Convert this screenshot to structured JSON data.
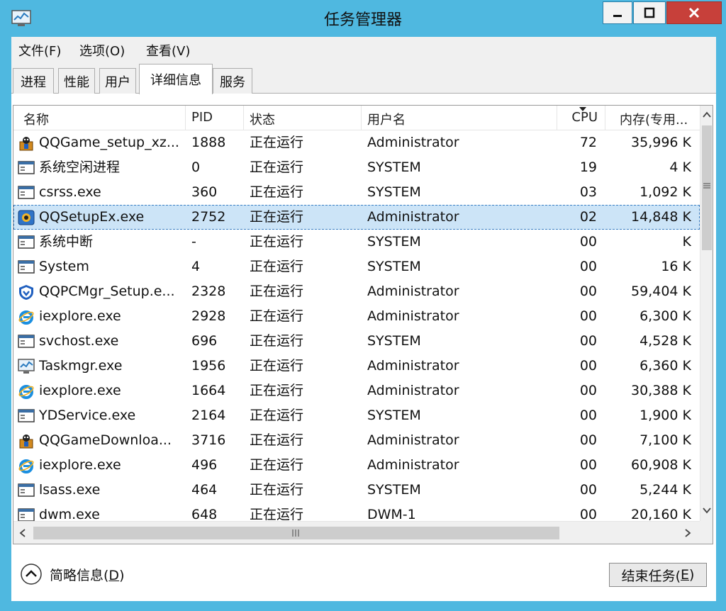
{
  "window": {
    "title": "任务管理器",
    "colors": {
      "frame": "#4fb8e0",
      "close": "#c7403a",
      "selection": "#cce4f7"
    }
  },
  "menu": {
    "items": [
      {
        "label": "文件(F)"
      },
      {
        "label": "选项(O)"
      },
      {
        "label": "查看(V)"
      }
    ]
  },
  "tabs": [
    {
      "label": "进程",
      "active": false
    },
    {
      "label": "性能",
      "active": false
    },
    {
      "label": "用户",
      "active": false
    },
    {
      "label": "详细信息",
      "active": true
    },
    {
      "label": "服务",
      "active": false
    }
  ],
  "table": {
    "columns": [
      {
        "label": "名称"
      },
      {
        "label": "PID"
      },
      {
        "label": "状态"
      },
      {
        "label": "用户名"
      },
      {
        "label": "CPU"
      },
      {
        "label": "内存(专用..."
      }
    ],
    "rows": [
      {
        "name": "QQGame_setup_xz...",
        "pid": "1888",
        "status": "正在运行",
        "user": "Administrator",
        "cpu": "72",
        "mem": "35,996 K",
        "icon": "qqgame-icon"
      },
      {
        "name": "系统空闲进程",
        "pid": "0",
        "status": "正在运行",
        "user": "SYSTEM",
        "cpu": "19",
        "mem": "4 K",
        "icon": "window-icon"
      },
      {
        "name": "csrss.exe",
        "pid": "360",
        "status": "正在运行",
        "user": "SYSTEM",
        "cpu": "03",
        "mem": "1,092 K",
        "icon": "window-icon"
      },
      {
        "name": "QQSetupEx.exe",
        "pid": "2752",
        "status": "正在运行",
        "user": "Administrator",
        "cpu": "02",
        "mem": "14,848 K",
        "icon": "qq-setup-icon",
        "selected": true
      },
      {
        "name": "系统中断",
        "pid": "-",
        "status": "正在运行",
        "user": "SYSTEM",
        "cpu": "00",
        "mem": "K",
        "icon": "window-icon"
      },
      {
        "name": "System",
        "pid": "4",
        "status": "正在运行",
        "user": "SYSTEM",
        "cpu": "00",
        "mem": "16 K",
        "icon": "window-icon"
      },
      {
        "name": "QQPCMgr_Setup.e...",
        "pid": "2328",
        "status": "正在运行",
        "user": "Administrator",
        "cpu": "00",
        "mem": "59,404 K",
        "icon": "shield-icon"
      },
      {
        "name": "iexplore.exe",
        "pid": "2928",
        "status": "正在运行",
        "user": "Administrator",
        "cpu": "00",
        "mem": "6,300 K",
        "icon": "ie-icon"
      },
      {
        "name": "svchost.exe",
        "pid": "696",
        "status": "正在运行",
        "user": "SYSTEM",
        "cpu": "00",
        "mem": "4,528 K",
        "icon": "window-icon"
      },
      {
        "name": "Taskmgr.exe",
        "pid": "1956",
        "status": "正在运行",
        "user": "Administrator",
        "cpu": "00",
        "mem": "6,360 K",
        "icon": "taskmgr-icon"
      },
      {
        "name": "iexplore.exe",
        "pid": "1664",
        "status": "正在运行",
        "user": "Administrator",
        "cpu": "00",
        "mem": "30,388 K",
        "icon": "ie-icon"
      },
      {
        "name": "YDService.exe",
        "pid": "2164",
        "status": "正在运行",
        "user": "SYSTEM",
        "cpu": "00",
        "mem": "1,900 K",
        "icon": "window-icon"
      },
      {
        "name": "QQGameDownloa...",
        "pid": "3716",
        "status": "正在运行",
        "user": "Administrator",
        "cpu": "00",
        "mem": "7,100 K",
        "icon": "qqgame-icon"
      },
      {
        "name": "iexplore.exe",
        "pid": "496",
        "status": "正在运行",
        "user": "Administrator",
        "cpu": "00",
        "mem": "60,908 K",
        "icon": "ie-icon"
      },
      {
        "name": "lsass.exe",
        "pid": "464",
        "status": "正在运行",
        "user": "SYSTEM",
        "cpu": "00",
        "mem": "5,244 K",
        "icon": "window-icon"
      },
      {
        "name": "dwm.exe",
        "pid": "648",
        "status": "正在运行",
        "user": "DWM-1",
        "cpu": "00",
        "mem": "20,160 K",
        "icon": "window-icon"
      }
    ]
  },
  "footer": {
    "less_details_label": "简略信息(",
    "less_details_key": "D",
    "less_details_suffix": ")",
    "end_task_label": "结束任务(",
    "end_task_key": "E",
    "end_task_suffix": ")"
  }
}
